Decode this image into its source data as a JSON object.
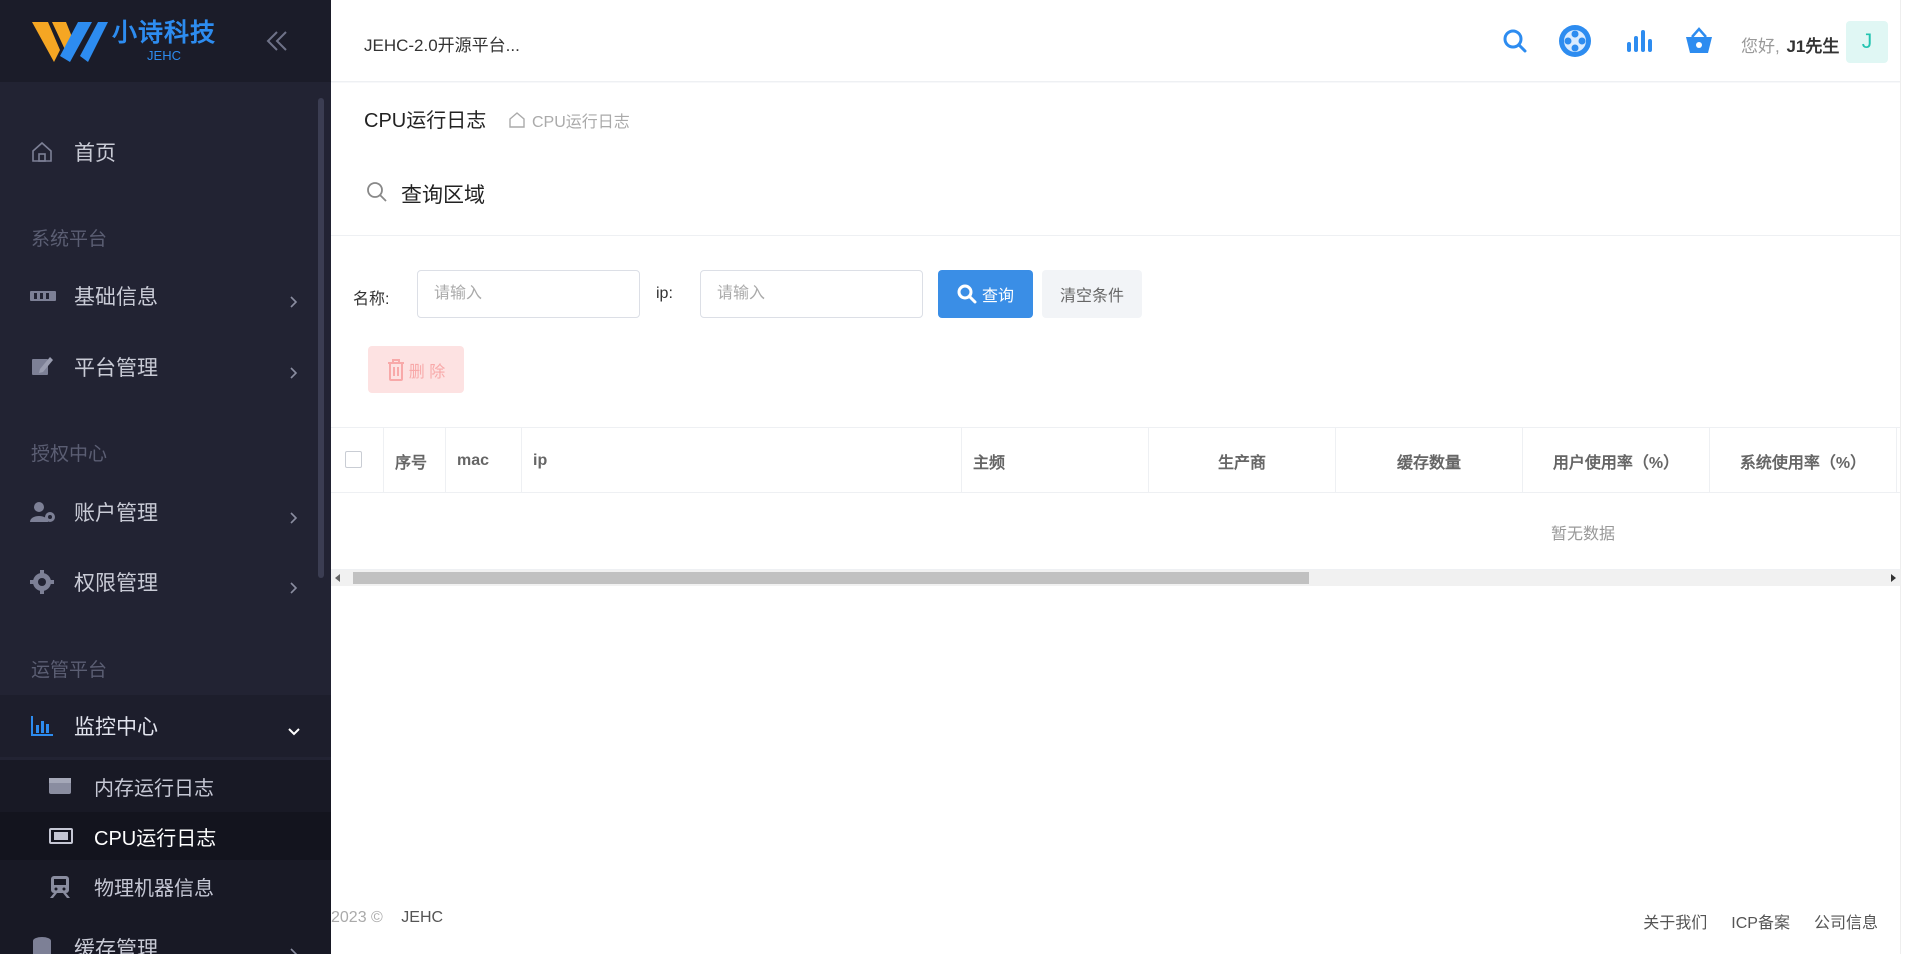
{
  "brand": {
    "name": "小诗科技",
    "sub": "JEHC",
    "color": "#2d8cf0"
  },
  "sidebar": {
    "home": "首页",
    "groups": [
      {
        "title": "系统平台"
      },
      {
        "title": "授权中心"
      },
      {
        "title": "运管平台"
      }
    ],
    "items": {
      "basic": "基础信息",
      "platform": "平台管理",
      "account": "账户管理",
      "permission": "权限管理",
      "monitor": "监控中心",
      "cache": "缓存管理"
    },
    "monitor_sub": [
      {
        "label": "内存运行日志",
        "icon": "wallet-icon"
      },
      {
        "label": "CPU运行日志",
        "icon": "cpu-icon",
        "active": true
      },
      {
        "label": "物理机器信息",
        "icon": "train-icon"
      }
    ]
  },
  "header": {
    "app_title": "JEHC-2.0开源平台...",
    "greeting": "您好,",
    "user": "J1先生",
    "avatar_letter": "J",
    "icons": [
      "search-icon",
      "apps-icon",
      "chart-bars-icon",
      "basket-icon"
    ]
  },
  "titlebar": {
    "title": "CPU运行日志",
    "breadcrumb": "CPU运行日志"
  },
  "query": {
    "title": "查询区域",
    "name_label": "名称:",
    "name_placeholder": "请输入",
    "ip_label": "ip:",
    "ip_placeholder": "请输入",
    "search_button": "查询",
    "clear_button": "清空条件",
    "delete_button": "删 除"
  },
  "table": {
    "columns": [
      "序号",
      "mac",
      "ip",
      "主频",
      "生产商",
      "缓存数量",
      "用户使用率（%）",
      "系统使用率（%）"
    ],
    "empty_text": "暂无数据"
  },
  "footer": {
    "year": "2023",
    "copyright": "©",
    "brand": "JEHC",
    "links": [
      "关于我们",
      "ICP备案",
      "公司信息"
    ]
  }
}
